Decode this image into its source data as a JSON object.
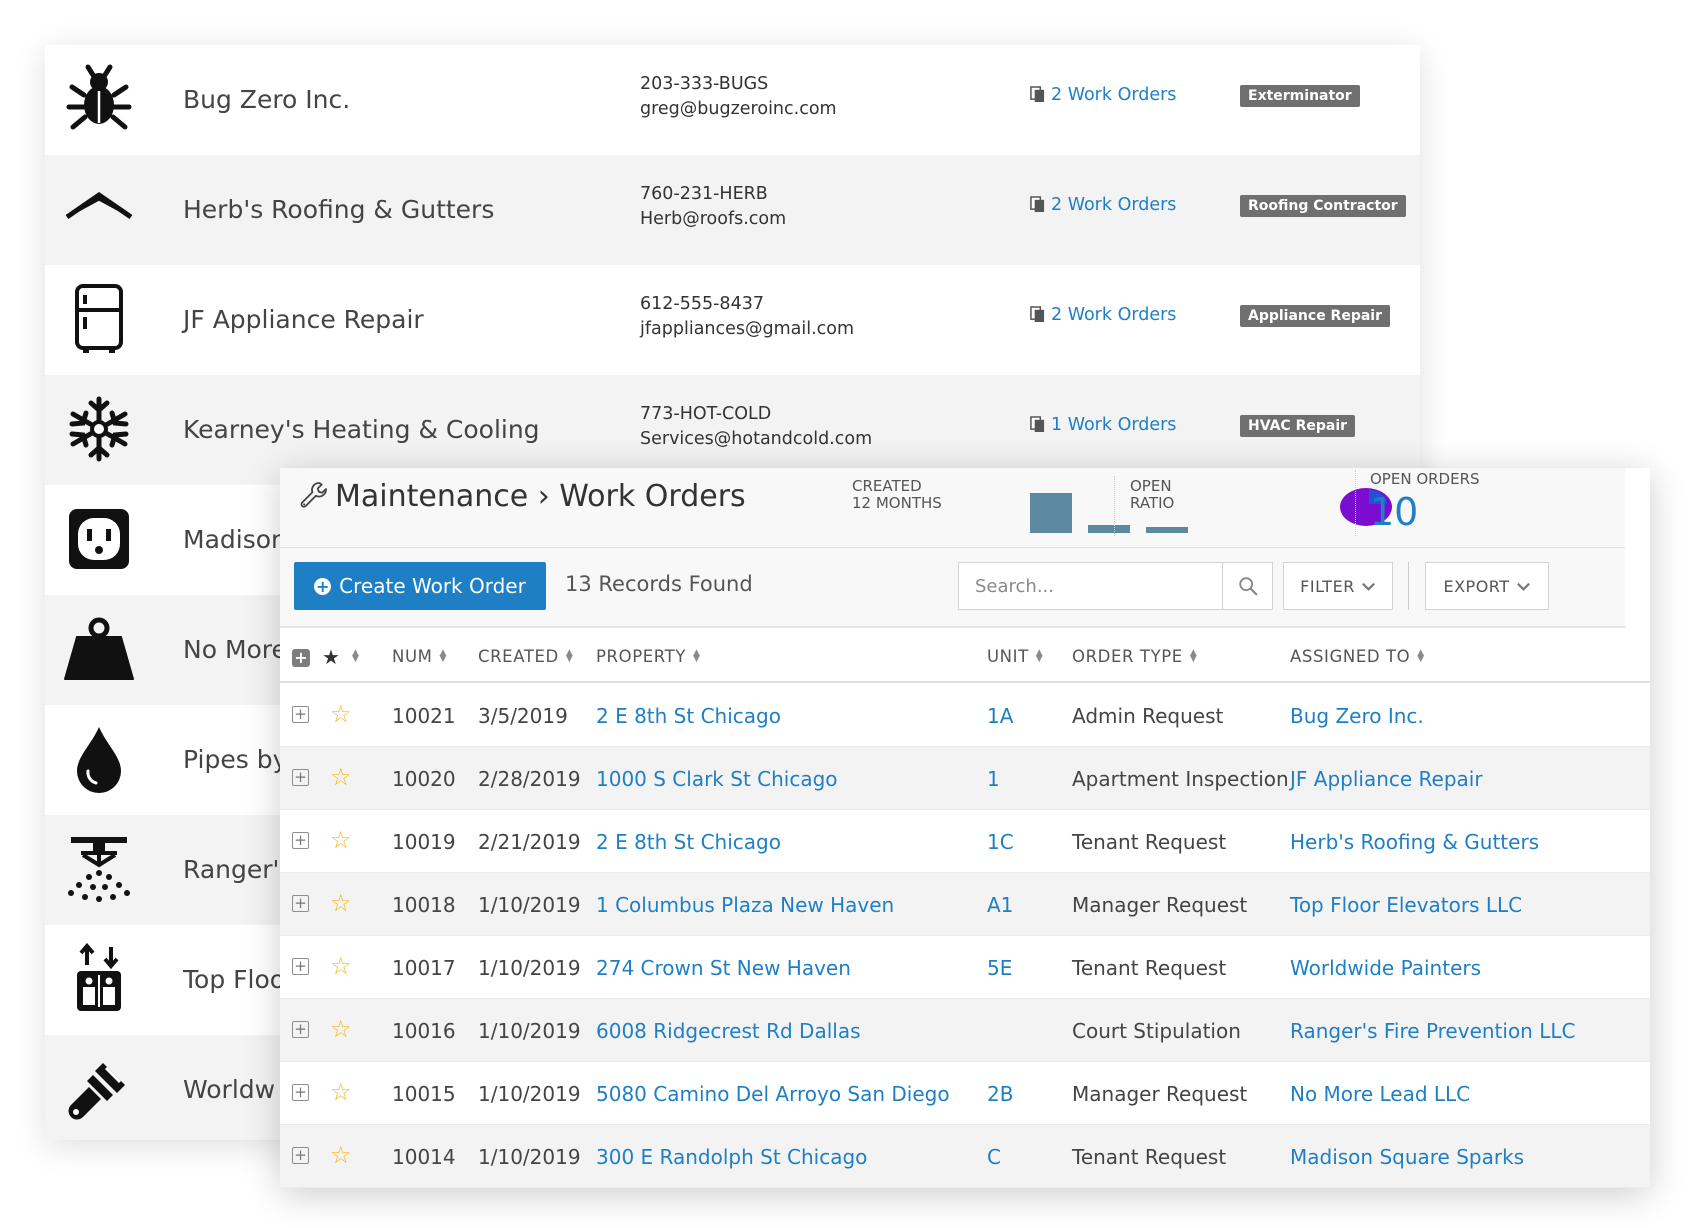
{
  "vendors": [
    {
      "icon": "bug-icon",
      "name": "Bug Zero Inc.",
      "phone": "203-333-BUGS",
      "email": "greg@bugzeroinc.com",
      "orders": "2 Work Orders",
      "category": "Exterminator"
    },
    {
      "icon": "roof-icon",
      "name": "Herb's Roofing & Gutters",
      "phone": "760-231-HERB",
      "email": "Herb@roofs.com",
      "orders": "2 Work Orders",
      "category": "Roofing Contractor"
    },
    {
      "icon": "refrigerator-icon",
      "name": "JF Appliance Repair",
      "phone": "612-555-8437",
      "email": "jfappliances@gmail.com",
      "orders": "2 Work Orders",
      "category": "Appliance Repair"
    },
    {
      "icon": "snowflake-icon",
      "name": "Kearney's Heating & Cooling",
      "phone": "773-HOT-COLD",
      "email": "Services@hotandcold.com",
      "orders": "1 Work Orders",
      "category": "HVAC Repair"
    },
    {
      "icon": "outlet-icon",
      "name": "Madison"
    },
    {
      "icon": "weight-icon",
      "name": "No More"
    },
    {
      "icon": "water-drop-icon",
      "name": "Pipes by"
    },
    {
      "icon": "sprinkler-icon",
      "name": "Ranger's"
    },
    {
      "icon": "elevator-icon",
      "name": "Top Floo"
    },
    {
      "icon": "paintbrush-icon",
      "name": "Worldw"
    }
  ],
  "workorders": {
    "title": "Maintenance › Work Orders",
    "stats": {
      "created_label_1": "CREATED",
      "created_label_2": "12 MONTHS",
      "created_bars": [
        1.0,
        0.2,
        0.1
      ],
      "open_ratio_label_1": "OPEN",
      "open_ratio_label_2": "RATIO",
      "open_orders_label": "OPEN ORDERS",
      "open_orders_value": "10",
      "bar_color": "#5b8aa0",
      "pie_color": "#7b0dd0",
      "pie_slice_color": "#2253d6"
    },
    "create_button": "Create Work Order",
    "records_found": "13 Records Found",
    "search_placeholder": "Search...",
    "filter_label": "FILTER",
    "export_label": "EXPORT",
    "columns": [
      "NUM",
      "CREATED",
      "PROPERTY",
      "UNIT",
      "ORDER TYPE",
      "ASSIGNED TO"
    ],
    "rows": [
      {
        "num": "10021",
        "created": "3/5/2019",
        "property": "2 E 8th St Chicago",
        "unit": "1A",
        "type": "Admin Request",
        "assigned": "Bug Zero Inc."
      },
      {
        "num": "10020",
        "created": "2/28/2019",
        "property": "1000 S Clark St Chicago",
        "unit": "1",
        "type": "Apartment Inspection",
        "assigned": "JF Appliance Repair"
      },
      {
        "num": "10019",
        "created": "2/21/2019",
        "property": "2 E 8th St Chicago",
        "unit": "1C",
        "type": "Tenant Request",
        "assigned": "Herb's Roofing & Gutters"
      },
      {
        "num": "10018",
        "created": "1/10/2019",
        "property": "1 Columbus Plaza New Haven",
        "unit": "A1",
        "type": "Manager Request",
        "assigned": "Top Floor Elevators LLC"
      },
      {
        "num": "10017",
        "created": "1/10/2019",
        "property": "274 Crown St New Haven",
        "unit": "5E",
        "type": "Tenant Request",
        "assigned": "Worldwide Painters"
      },
      {
        "num": "10016",
        "created": "1/10/2019",
        "property": "6008 Ridgecrest Rd Dallas",
        "unit": "",
        "type": "Court Stipulation",
        "assigned": "Ranger's Fire Prevention LLC"
      },
      {
        "num": "10015",
        "created": "1/10/2019",
        "property": "5080 Camino Del Arroyo San Diego",
        "unit": "2B",
        "type": "Manager Request",
        "assigned": "No More Lead LLC"
      },
      {
        "num": "10014",
        "created": "1/10/2019",
        "property": "300 E Randolph St Chicago",
        "unit": "C",
        "type": "Tenant Request",
        "assigned": "Madison Square Sparks"
      }
    ]
  }
}
